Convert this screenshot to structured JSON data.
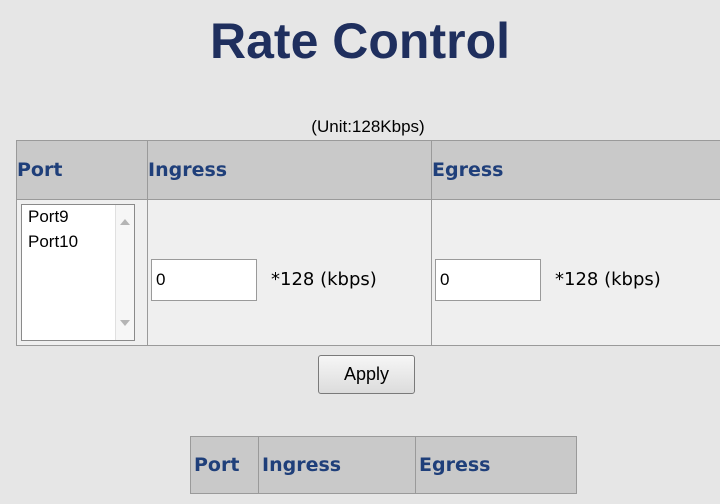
{
  "page": {
    "title": "Rate Control",
    "unit_note": "(Unit:128Kbps)"
  },
  "main_table": {
    "headers": {
      "port": "Port",
      "ingress": "Ingress",
      "egress": "Egress"
    },
    "port_list": [
      "Port9",
      "Port10"
    ],
    "ingress": {
      "value": "0",
      "suffix": "*128 (kbps)"
    },
    "egress": {
      "value": "0",
      "suffix": "*128 (kbps)"
    }
  },
  "apply_button": {
    "label": "Apply"
  },
  "summary_table": {
    "headers": {
      "port": "Port",
      "ingress": "Ingress",
      "egress": "Egress"
    }
  },
  "colors": {
    "title": "#1f2f5e",
    "header_text": "#1f3f7a",
    "header_bg": "#c9c9c9",
    "page_bg": "#e6e6e6"
  }
}
